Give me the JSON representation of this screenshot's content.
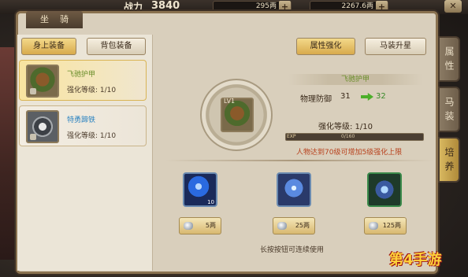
{
  "topbar": {
    "power_label": "战力",
    "power_value": "3840",
    "gold_value": "295两",
    "silver_value": "2267.6两",
    "plus_label": "+",
    "close_label": "✕"
  },
  "panel": {
    "title": "坐骑",
    "tabs": {
      "body_equip": "身上装备",
      "bag_equip": "背包装备"
    },
    "actions": {
      "attr_enhance": "属性强化",
      "horse_upgrade": "马装升星"
    }
  },
  "items": [
    {
      "name": "飞驰护甲",
      "level": "强化等级: 1/10",
      "icon": "armor-icon"
    },
    {
      "name": "特勇蹄铁",
      "level": "强化等级: 1/10",
      "icon": "horseshoe-icon"
    }
  ],
  "detail": {
    "equip_level_tag": "LV1",
    "name": "飞驰护甲",
    "stat_label": "物理防御",
    "stat_current": "31",
    "stat_next": "32",
    "level_text": "强化等级: 1/10",
    "exp_tag": "EXP",
    "exp_text": "0/160",
    "note": "人物达到70级可增加5级强化上限"
  },
  "materials": [
    {
      "icon": "blue-orb-icon",
      "count": "10",
      "cost": "5两"
    },
    {
      "icon": "blue-crystal-icon",
      "count": "",
      "cost": "25两"
    },
    {
      "icon": "green-crystal-icon",
      "count": "",
      "cost": "125两"
    }
  ],
  "hint": "长按按钮可连续使用",
  "side_tabs": [
    "属性",
    "马装",
    "培养"
  ],
  "watermark": "第4手游",
  "colors": {
    "accent": "#d8aa4c",
    "green_stat": "#3a8a2a",
    "note_red": "#b8401c"
  }
}
